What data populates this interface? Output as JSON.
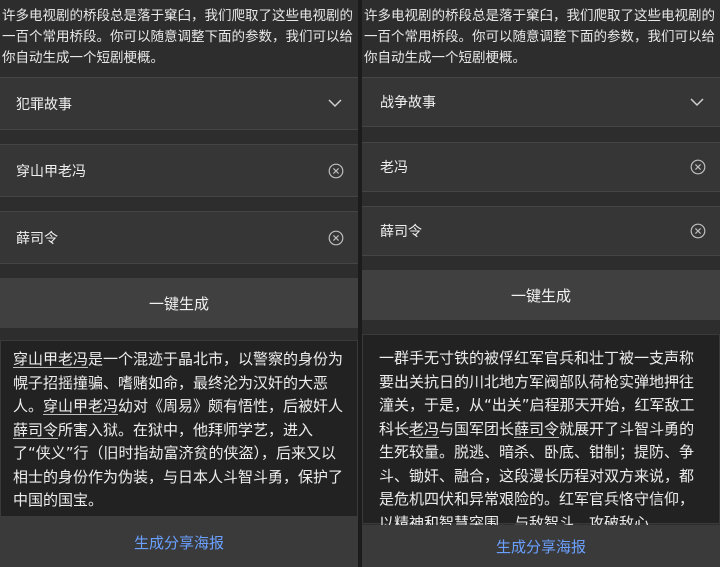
{
  "intro": "许多电视剧的桥段总是落于窠臼，我们爬取了这些电视剧的一百个常用桥段。你可以随意调整下面的参数，我们可以给你自动生成一个短剧梗概。",
  "left": {
    "genre": "犯罪故事",
    "protagonist": "穿山甲老冯",
    "antagonist": "薛司令",
    "generate_label": "一键生成",
    "story": {
      "p1": "穿山甲老冯",
      "p2": "是一个混迹于晶北市，以警察的身份为幌子招摇撞骗、嗜赌如命，最终沦为汉奸的大恶人。",
      "p3": "穿山甲老冯",
      "p4": "幼对《周易》颇有悟性，后被奸人",
      "p5": "薛司令",
      "p6": "所害入狱。在狱中，他拜师学艺，进入了“侠义”行（旧时指劫富济贫的侠盗），后来又以相士的身份作为伪装，与日本人斗智斗勇，保护了中国的国宝。"
    },
    "poster_label": "生成分享海报"
  },
  "right": {
    "genre": "战争故事",
    "protagonist": "老冯",
    "antagonist": "薛司令",
    "generate_label": "一键生成",
    "story": {
      "p1": "一群手无寸铁的被俘红军官兵和壮丁被一支声称要出关抗日的川北地方军阀部队荷枪实弹地押往潼关，于是，从“出关”启程那天开始，红军敌工科长",
      "p2": "老冯",
      "p3": "与国军团长",
      "p4": "薛司令",
      "p5": "就展开了斗智斗勇的生死较量。脱逃、暗杀、卧底、钳制；提防、争斗、锄奸、融合，这段漫长历程对双方来说，都是危机四伏和异常艰险的。红军官兵恪守信仰，以精神和智慧突围，与敌智斗，攻破敌心......"
    },
    "poster_label": "生成分享海报"
  },
  "colors": {
    "accent": "#6aa0ff",
    "background": "#2d2d2d"
  },
  "icons": {
    "dropdown": "chevron-down-icon",
    "clear": "clear-circle-x-icon"
  }
}
